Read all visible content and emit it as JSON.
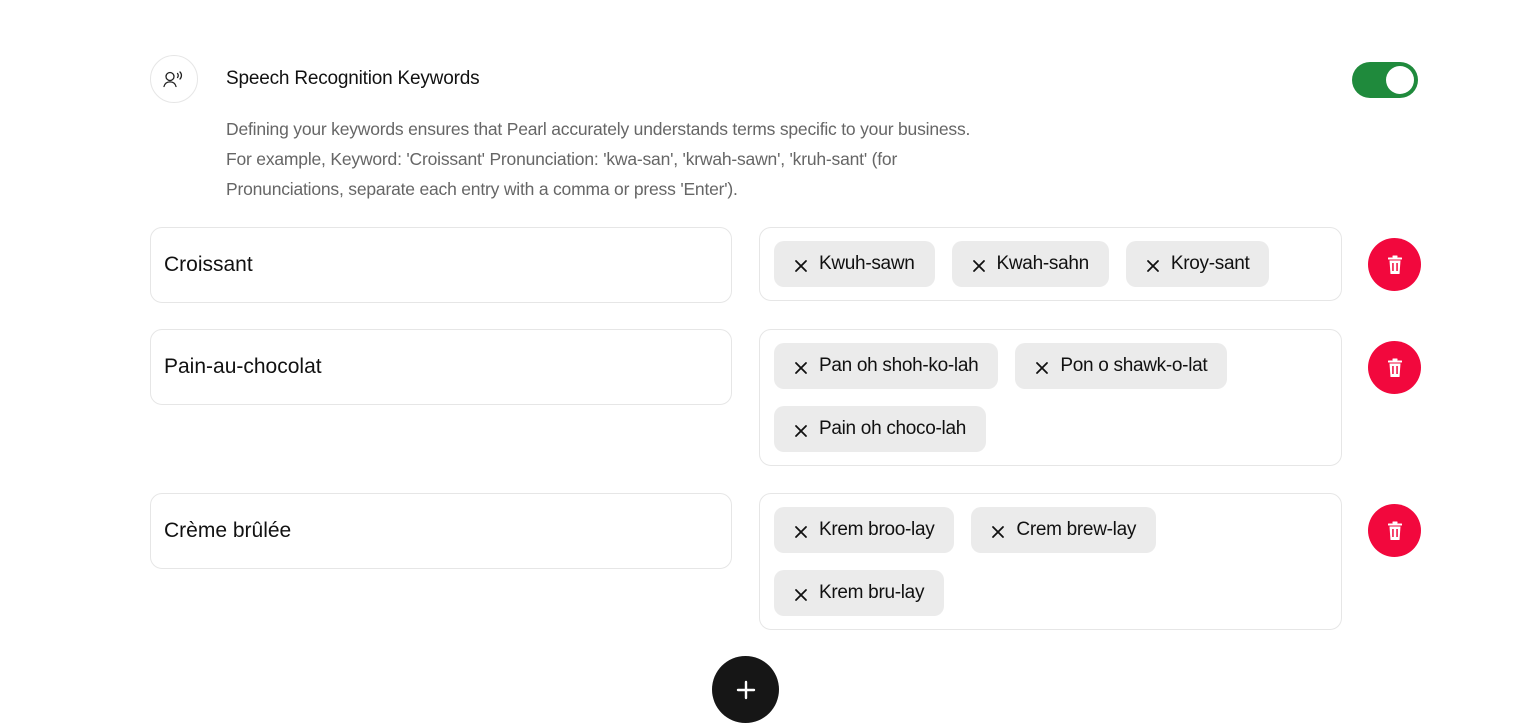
{
  "header": {
    "title": "Speech Recognition Keywords",
    "description": "Defining your keywords ensures that Pearl accurately understands terms specific to your business. For example, Keyword: 'Croissant' Pronunciation: 'kwa-san', 'krwah-sawn', 'kruh-sant' (for Pronunciations, separate each entry with a comma or press 'Enter').",
    "icon": "speech-icon",
    "toggle_on": true,
    "toggle_color": "#1f8a3c"
  },
  "keywords": [
    {
      "keyword": "Croissant",
      "pronunciations": [
        "Kwuh-sawn",
        "Kwah-sahn",
        "Kroy-sant"
      ]
    },
    {
      "keyword": "Pain-au-chocolat",
      "pronunciations": [
        "Pan oh shoh-ko-lah",
        "Pon o shawk-o-lat",
        "Pain oh choco-lah"
      ]
    },
    {
      "keyword": "Crème brûlée",
      "pronunciations": [
        "Krem broo-lay",
        "Crem brew-lay",
        "Krem bru-lay"
      ]
    }
  ],
  "icons": {
    "remove": "close-icon",
    "delete": "trash-icon",
    "add": "plus-icon"
  },
  "colors": {
    "delete_button": "#f2083d",
    "add_button": "#161616",
    "chip_bg": "#ebebeb"
  }
}
